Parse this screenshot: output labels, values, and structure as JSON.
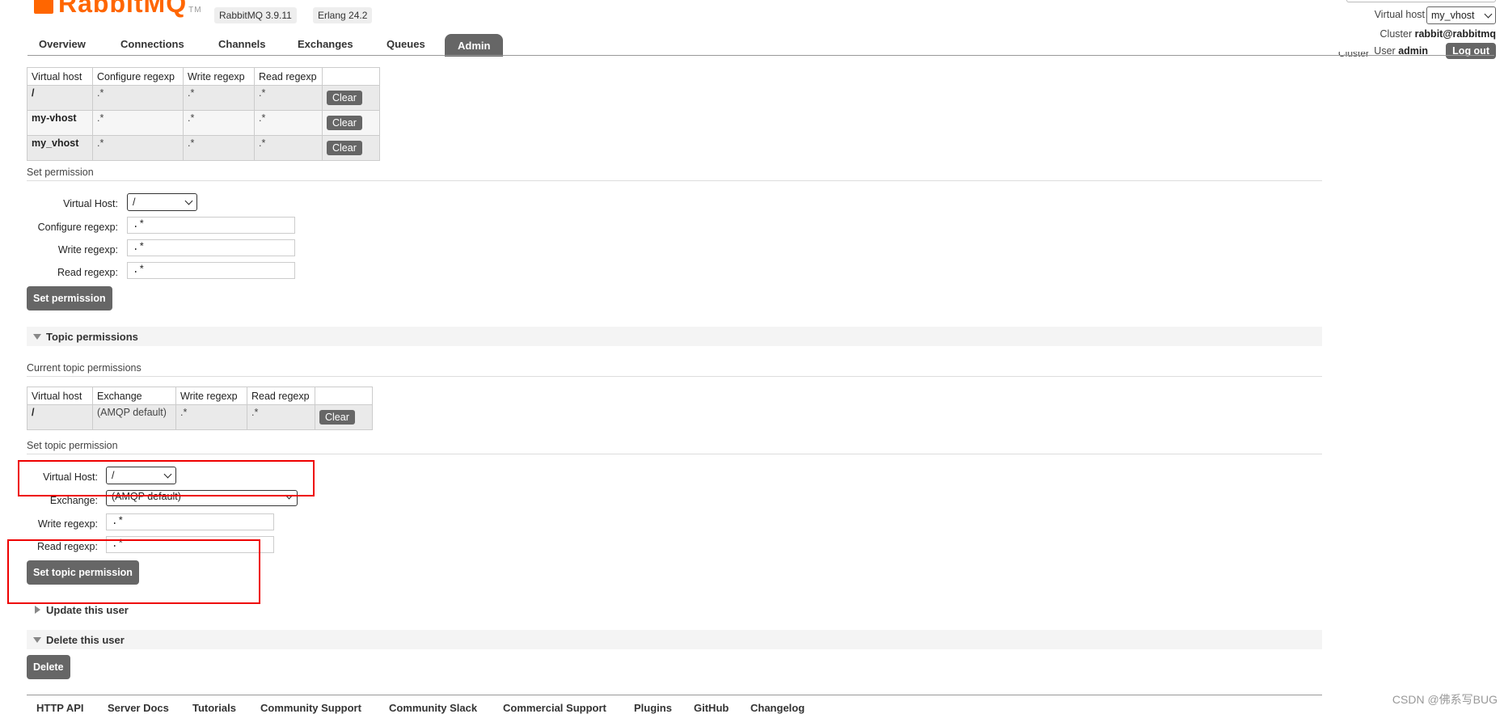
{
  "header": {
    "logo_text": "RabbitMQ",
    "logo_tm": "TM",
    "rabbitmq_version": "RabbitMQ 3.9.11",
    "erlang_version": "Erlang 24.2",
    "virtual_host_label": "Virtual host",
    "virtual_host_value": "my_vhost",
    "cluster_label": "Cluster",
    "cluster_name": "rabbit@rabbitmq",
    "user_label": "User",
    "user_name": "admin",
    "logout_label": "Log out",
    "cluster_ghost": "Cluster"
  },
  "nav": {
    "tabs": [
      "Overview",
      "Connections",
      "Channels",
      "Exchanges",
      "Queues",
      "Admin"
    ],
    "active": "Admin"
  },
  "permissions_table": {
    "headers": [
      "Virtual host",
      "Configure regexp",
      "Write regexp",
      "Read regexp",
      ""
    ],
    "rows": [
      {
        "vhost": "/",
        "configure": ".*",
        "write": ".*",
        "read": ".*",
        "action": "Clear"
      },
      {
        "vhost": "my-vhost",
        "configure": ".*",
        "write": ".*",
        "read": ".*",
        "action": "Clear"
      },
      {
        "vhost": "my_vhost",
        "configure": ".*",
        "write": ".*",
        "read": ".*",
        "action": "Clear"
      }
    ]
  },
  "set_permission": {
    "title": "Set permission",
    "virtual_host_label": "Virtual Host:",
    "virtual_host_value": "/",
    "configure_label": "Configure regexp:",
    "configure_value": ".*",
    "write_label": "Write regexp:",
    "write_value": ".*",
    "read_label": "Read regexp:",
    "read_value": ".*",
    "button": "Set permission"
  },
  "topic_permissions": {
    "section_title": "Topic permissions",
    "current_title": "Current topic permissions",
    "headers": [
      "Virtual host",
      "Exchange",
      "Write regexp",
      "Read regexp",
      ""
    ],
    "rows": [
      {
        "vhost": "/",
        "exchange": "(AMQP default)",
        "write": ".*",
        "read": ".*",
        "action": "Clear"
      }
    ]
  },
  "set_topic_permission": {
    "title": "Set topic permission",
    "virtual_host_label": "Virtual Host:",
    "virtual_host_value": "/",
    "exchange_label": "Exchange:",
    "exchange_value": "(AMQP default)",
    "write_label": "Write regexp:",
    "write_value": ".*",
    "read_label": "Read regexp:",
    "read_value": ".*",
    "button": "Set topic permission"
  },
  "update_user": {
    "title": "Update this user"
  },
  "delete_user": {
    "title": "Delete this user",
    "button": "Delete"
  },
  "footer": {
    "links": [
      "HTTP API",
      "Server Docs",
      "Tutorials",
      "Community Support",
      "Community Slack",
      "Commercial Support",
      "Plugins",
      "GitHub",
      "Changelog"
    ]
  },
  "watermark": "CSDN @佛系写BUG",
  "colors": {
    "brand": "#ff6600",
    "button": "#666666",
    "highlight": "#ee0000"
  }
}
